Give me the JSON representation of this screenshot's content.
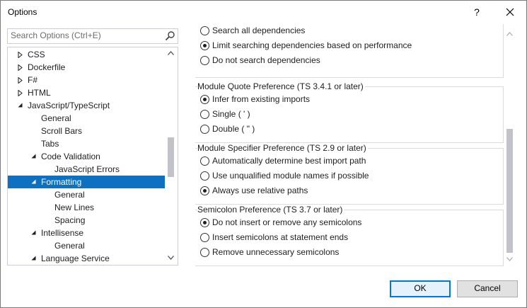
{
  "window": {
    "title": "Options",
    "help_label": "?"
  },
  "search": {
    "placeholder": "Search Options (Ctrl+E)"
  },
  "tree": {
    "items": [
      {
        "label": "CSS",
        "level": 0,
        "arrow": "collapsed",
        "selected": false
      },
      {
        "label": "Dockerfile",
        "level": 0,
        "arrow": "collapsed",
        "selected": false
      },
      {
        "label": "F#",
        "level": 0,
        "arrow": "collapsed",
        "selected": false
      },
      {
        "label": "HTML",
        "level": 0,
        "arrow": "collapsed",
        "selected": false
      },
      {
        "label": "JavaScript/TypeScript",
        "level": 0,
        "arrow": "expanded",
        "selected": false
      },
      {
        "label": "General",
        "level": 1,
        "arrow": "none",
        "selected": false
      },
      {
        "label": "Scroll Bars",
        "level": 1,
        "arrow": "none",
        "selected": false
      },
      {
        "label": "Tabs",
        "level": 1,
        "arrow": "none",
        "selected": false
      },
      {
        "label": "Code Validation",
        "level": 1,
        "arrow": "expanded",
        "selected": false
      },
      {
        "label": "JavaScript Errors",
        "level": 2,
        "arrow": "none",
        "selected": false
      },
      {
        "label": "Formatting",
        "level": 1,
        "arrow": "expanded",
        "selected": true
      },
      {
        "label": "General",
        "level": 2,
        "arrow": "none",
        "selected": false
      },
      {
        "label": "New Lines",
        "level": 2,
        "arrow": "none",
        "selected": false
      },
      {
        "label": "Spacing",
        "level": 2,
        "arrow": "none",
        "selected": false
      },
      {
        "label": "Intellisense",
        "level": 1,
        "arrow": "expanded",
        "selected": false
      },
      {
        "label": "General",
        "level": 2,
        "arrow": "none",
        "selected": false
      },
      {
        "label": "Language Service",
        "level": 1,
        "arrow": "expanded",
        "selected": false
      }
    ]
  },
  "groups": [
    {
      "title": "",
      "options": [
        {
          "label": "Search all dependencies",
          "checked": false
        },
        {
          "label": "Limit searching dependencies based on performance",
          "checked": true
        },
        {
          "label": "Do not search dependencies",
          "checked": false
        }
      ]
    },
    {
      "title": "Module Quote Preference (TS 3.4.1 or later)",
      "options": [
        {
          "label": "Infer from existing imports",
          "checked": true
        },
        {
          "label": "Single ( ' )",
          "checked": false
        },
        {
          "label": "Double ( \" )",
          "checked": false
        }
      ]
    },
    {
      "title": "Module Specifier Preference (TS 2.9 or later)",
      "options": [
        {
          "label": "Automatically determine best import path",
          "checked": false
        },
        {
          "label": "Use unqualified module names if possible",
          "checked": false
        },
        {
          "label": "Always use relative paths",
          "checked": true
        }
      ]
    },
    {
      "title": "Semicolon Preference (TS 3.7 or later)",
      "options": [
        {
          "label": "Do not insert or remove any semicolons",
          "checked": true
        },
        {
          "label": "Insert semicolons at statement ends",
          "checked": false
        },
        {
          "label": "Remove unnecessary semicolons",
          "checked": false
        }
      ]
    }
  ],
  "buttons": {
    "ok": "OK",
    "cancel": "Cancel"
  },
  "colors": {
    "selection": "#0e70c0",
    "ok_border": "#0078d7",
    "scroll_thumb": "#c2c3c9"
  }
}
